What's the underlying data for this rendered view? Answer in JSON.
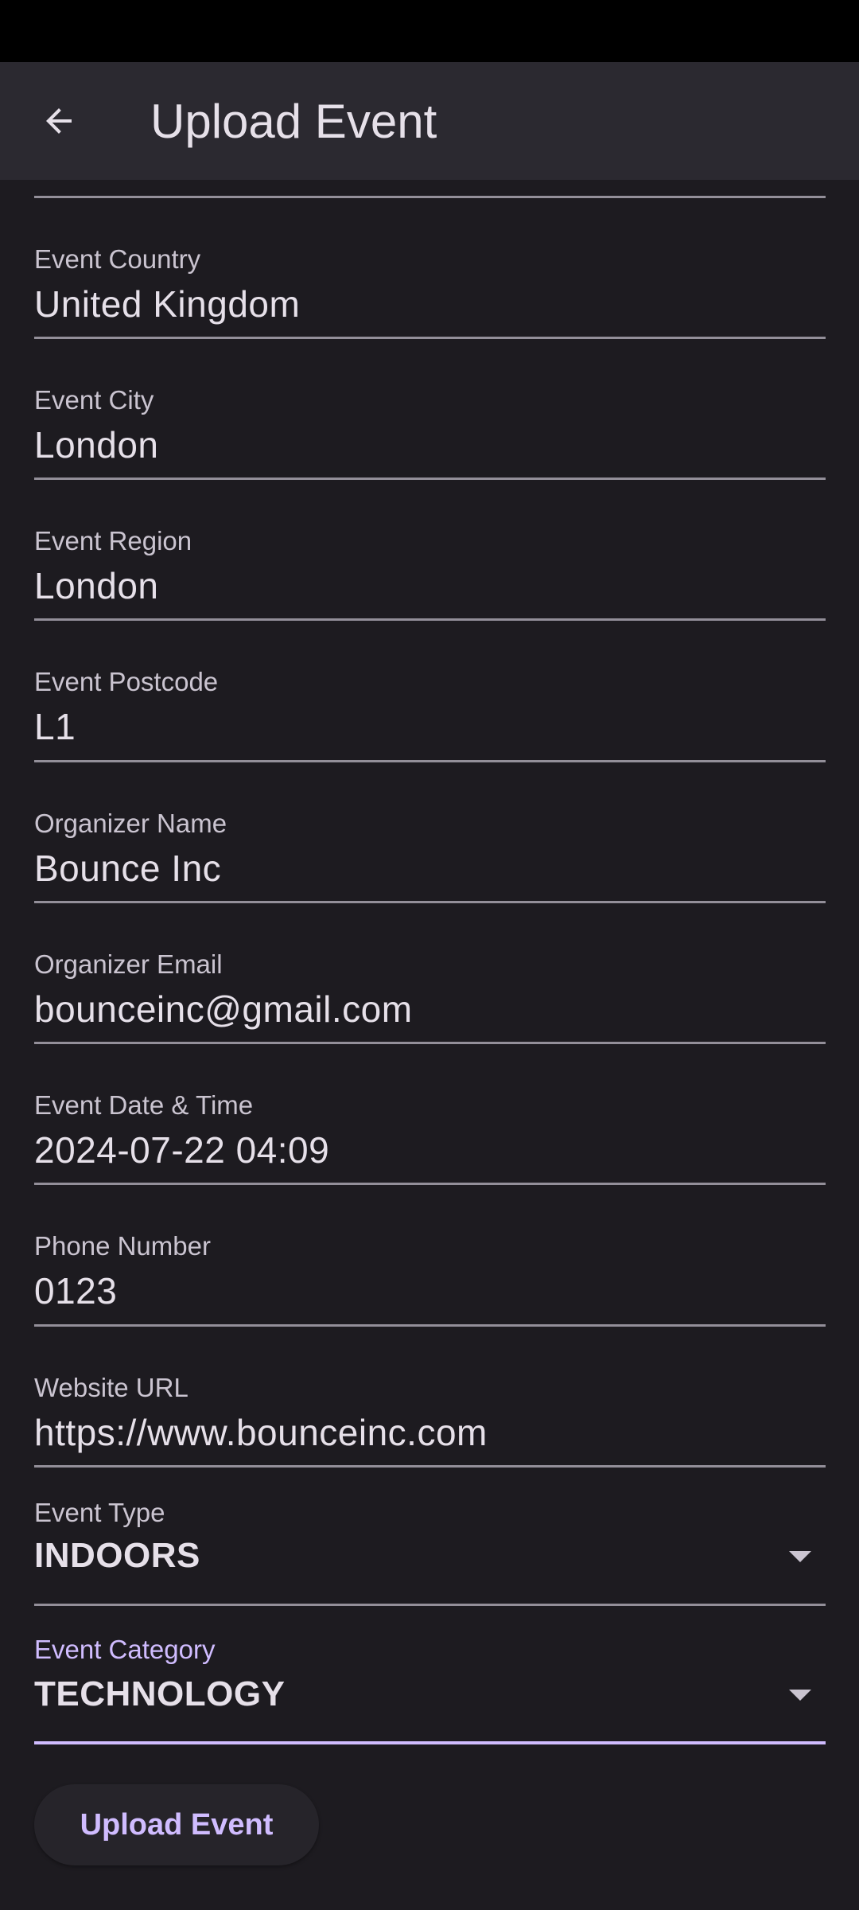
{
  "app_bar": {
    "title": "Upload Event",
    "back_icon": "arrow-back-icon"
  },
  "fields": [
    {
      "label": "Event Country",
      "value": "United Kingdom"
    },
    {
      "label": "Event City",
      "value": "London"
    },
    {
      "label": "Event Region",
      "value": "London"
    },
    {
      "label": "Event Postcode",
      "value": "L1"
    },
    {
      "label": "Organizer Name",
      "value": "Bounce Inc"
    },
    {
      "label": "Organizer Email",
      "value": "bounceinc@gmail.com"
    },
    {
      "label": "Event Date & Time",
      "value": "2024-07-22 04:09"
    },
    {
      "label": "Phone Number",
      "value": "0123"
    },
    {
      "label": "Website URL",
      "value": "https://www.bounceinc.com"
    }
  ],
  "event_type": {
    "label": "Event Type",
    "value": "INDOORS",
    "icon": "dropdown-arrow-icon"
  },
  "event_category": {
    "label": "Event Category",
    "value": "TECHNOLOGY",
    "icon": "dropdown-arrow-icon",
    "focused": true
  },
  "upload_button": {
    "label": "Upload Event"
  },
  "colors": {
    "background": "#1d1b20",
    "app_bar": "#2b2930",
    "accent": "#d0bcff",
    "divider": "#938f99",
    "text": "#e6e0e9",
    "label_text": "#cac4d0"
  }
}
